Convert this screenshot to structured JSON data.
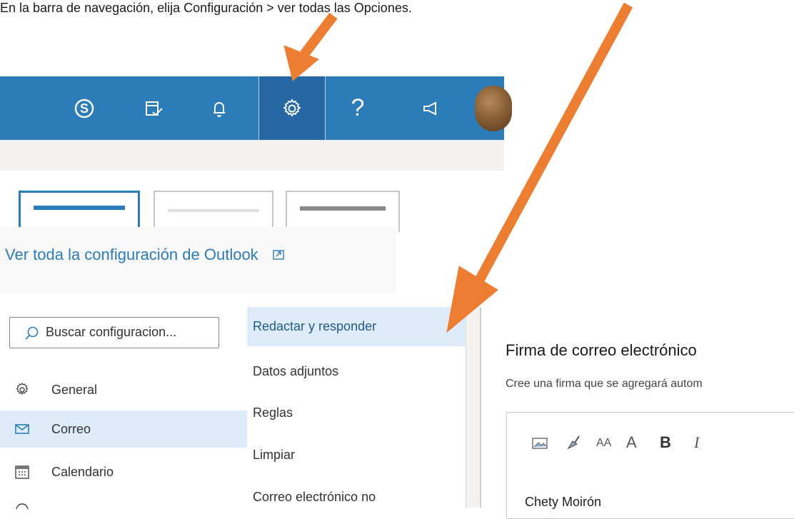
{
  "caption": "En la barra de navegación, elija Configuración > ver todas las Opciones.",
  "navbar": {
    "icons": [
      "skype-icon",
      "tasks-icon",
      "bell-icon",
      "gear-icon",
      "help-icon",
      "megaphone-icon",
      "avatar"
    ],
    "help_label": "?",
    "colors": {
      "bar": "#2b7cb9",
      "selected": "#2467a2"
    }
  },
  "quick_settings": {
    "outlook_link": "Ver toda la configuración de Outlook"
  },
  "settings": {
    "search_placeholder": "Buscar configuracion...",
    "nav": [
      {
        "label": "General",
        "icon": "gear-icon"
      },
      {
        "label": "Correo",
        "icon": "mail-icon",
        "selected": true
      },
      {
        "label": "Calendario",
        "icon": "calendar-icon"
      }
    ],
    "subnav": [
      {
        "label": "Redactar y responder",
        "selected": true
      },
      {
        "label": "Datos adjuntos"
      },
      {
        "label": "Reglas"
      },
      {
        "label": "Limpiar"
      },
      {
        "label": "Correo electrónico no"
      }
    ],
    "signature": {
      "title": "Firma de correo electrónico",
      "description": "Cree una firma que se agregará autom",
      "toolbar": {
        "font_size": "AA",
        "font_grow": "A",
        "bold": "B",
        "italic": "I"
      },
      "name": "Chety Moirón"
    }
  },
  "annotation_color": "#ed7d31"
}
